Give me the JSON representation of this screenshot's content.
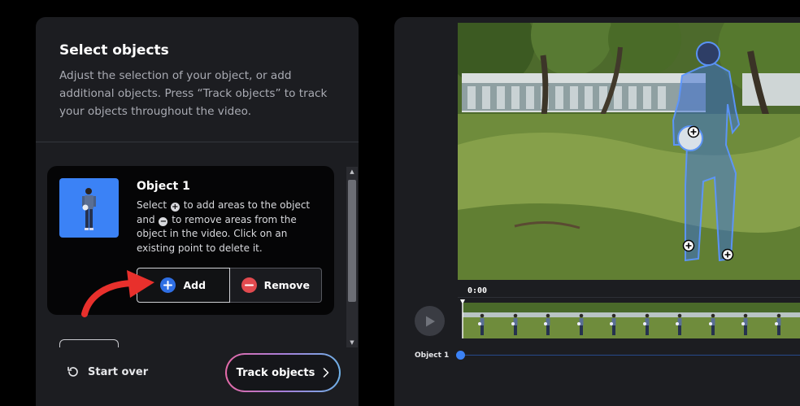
{
  "left_panel": {
    "title": "Select objects",
    "description": "Adjust the selection of your object, or add additional objects. Press “Track objects” to track your objects throughout the video.",
    "object_card": {
      "title": "Object 1",
      "help_select": "Select",
      "help_add": "to add areas to the object and",
      "help_remove": "to remove areas from the object in the video. Click on an existing point to delete it.",
      "add_label": "Add",
      "remove_label": "Remove"
    },
    "start_over_label": "Start over",
    "track_label": "Track objects"
  },
  "player": {
    "timecode": "0:00",
    "track_label": "Object 1"
  },
  "colors": {
    "accent_blue": "#3b82f6",
    "remove_red": "#e24a4f",
    "annotation_red": "#e8302c",
    "panel_bg": "#1c1d21"
  }
}
